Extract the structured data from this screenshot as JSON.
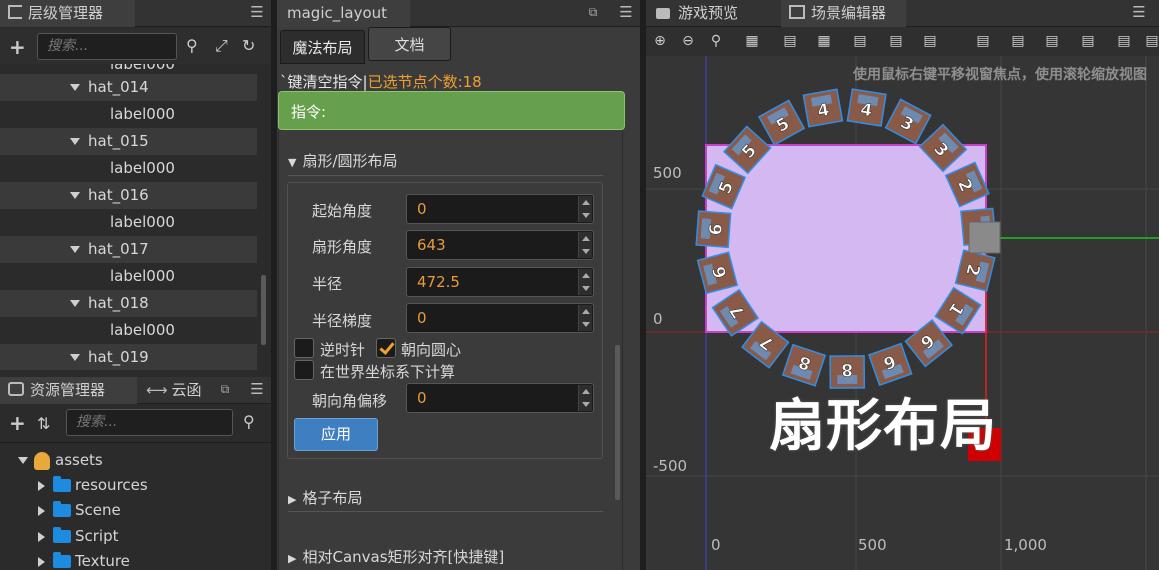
{
  "hierarchy": {
    "title": "层级管理器",
    "search_placeholder": "搜索...",
    "rows": [
      {
        "label": "label000",
        "type": "leaf"
      },
      {
        "label": "hat_014",
        "type": "node"
      },
      {
        "label": "label000",
        "type": "leaf"
      },
      {
        "label": "hat_015",
        "type": "node"
      },
      {
        "label": "label000",
        "type": "leaf"
      },
      {
        "label": "hat_016",
        "type": "node"
      },
      {
        "label": "label000",
        "type": "leaf"
      },
      {
        "label": "hat_017",
        "type": "node"
      },
      {
        "label": "label000",
        "type": "leaf"
      },
      {
        "label": "hat_018",
        "type": "node"
      },
      {
        "label": "label000",
        "type": "leaf"
      },
      {
        "label": "hat_019",
        "type": "node"
      }
    ]
  },
  "assets": {
    "title": "资源管理器",
    "tab2": "云函",
    "search_placeholder": "搜索...",
    "root": "assets",
    "items": [
      "resources",
      "Scene",
      "Script",
      "Texture"
    ]
  },
  "inspector": {
    "title": "magic_layout",
    "tab_active": "魔法布局",
    "tab_docs": "文档",
    "status_prefix": "`键清空指令|",
    "status_selected": "已选节点个数:18",
    "command_label": "指令:",
    "section_fan": "扇形/圆形布局",
    "fields": {
      "start_angle": {
        "label": "起始角度",
        "value": "0"
      },
      "fan_angle": {
        "label": "扇形角度",
        "value": "643"
      },
      "radius": {
        "label": "半径",
        "value": "472.5"
      },
      "radius_gradient": {
        "label": "半径梯度",
        "value": "0"
      },
      "facing_offset": {
        "label": "朝向角偏移",
        "value": "0"
      }
    },
    "counterclockwise": {
      "label": "逆时针",
      "checked": false
    },
    "face_center": {
      "label": "朝向圆心",
      "checked": true
    },
    "world_coords": {
      "label": "在世界坐标系下计算",
      "checked": false
    },
    "apply_label": "应用",
    "section_grid": "格子布局",
    "section_canvas": "相对Canvas矩形对齐[快捷键]"
  },
  "scene": {
    "tab_preview": "游戏预览",
    "tab_editor": "场景编辑器",
    "hint": "使用鼠标右键平移视窗焦点，使用滚轮缩放视图",
    "y_labels": [
      "500",
      "0",
      "-500"
    ],
    "x_labels": [
      "0",
      "500",
      "1,000"
    ],
    "caption": "扇形布局",
    "ring_digits": [
      "4",
      "4",
      "3",
      "3",
      "2",
      "2",
      "2",
      "1",
      "6",
      "6",
      "8",
      "8",
      "7",
      "7",
      "6",
      "6",
      "5",
      "5",
      "5"
    ]
  },
  "colors": {
    "accent_orange": "#f0a030",
    "command_green": "#67a04c",
    "apply_blue": "#3d7fc0",
    "scene_rect": "#d3b8f2",
    "scene_rect_border": "#c83fc8",
    "ring_outline": "#2f8fe8"
  }
}
